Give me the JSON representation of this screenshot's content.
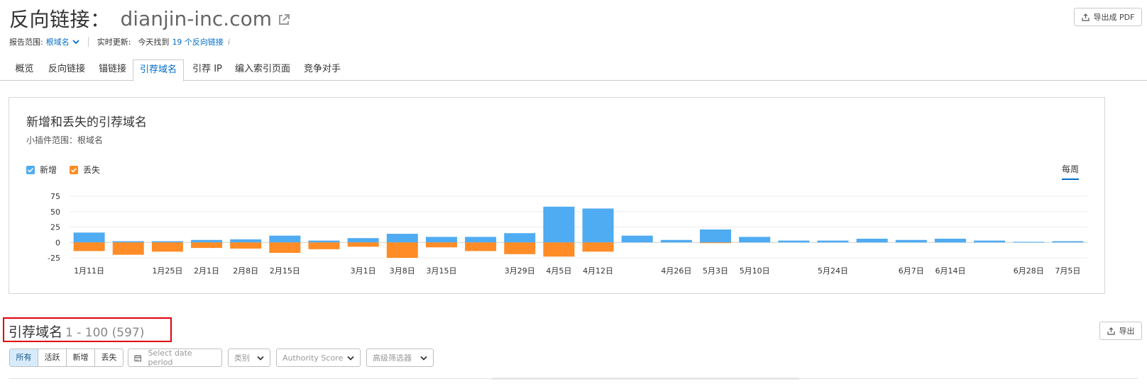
{
  "header": {
    "title": "反向链接：",
    "domain": "dianjin-inc.com",
    "export_pdf": "导出成 PDF"
  },
  "meta": {
    "scope_label": "报告范围:",
    "scope_value": "根域名",
    "realtime_label": "实时更新:",
    "today_prefix": "今天找到",
    "today_link": "19 个反向链接",
    "info": "i"
  },
  "tabs": [
    {
      "label": "概览"
    },
    {
      "label": "反向链接"
    },
    {
      "label": "锚链接"
    },
    {
      "label": "引荐域名"
    },
    {
      "label": "引荐 IP"
    },
    {
      "label": "编入索引页面"
    },
    {
      "label": "竞争对手"
    }
  ],
  "chart_card": {
    "title": "新增和丢失的引荐域名",
    "subtitle": "小插件范围：根域名",
    "legend_new": "新增",
    "legend_lost": "丢失",
    "period": "每周"
  },
  "colors": {
    "new": "#4fabf2",
    "lost": "#ff8c26",
    "accent": "#006dca",
    "highlight": "#e0000b"
  },
  "chart_data": {
    "type": "bar",
    "y_ticks": [
      "75",
      "50",
      "25",
      "0",
      "-25"
    ],
    "ylim": [
      -25,
      75
    ],
    "x_labels": [
      "1月11日",
      "",
      "1月25日",
      "2月1日",
      "2月8日",
      "2月15日",
      "",
      "3月1日",
      "3月8日",
      "3月15日",
      "",
      "3月29日",
      "4月5日",
      "4月12日",
      "",
      "4月26日",
      "5月3日",
      "5月10日",
      "",
      "5月24日",
      "",
      "6月7日",
      "6月14日",
      "",
      "6月28日",
      "7月5日"
    ],
    "series": [
      {
        "name": "新增",
        "values": [
          16,
          2,
          2,
          4,
          5,
          11,
          3,
          7,
          14,
          9,
          9,
          15,
          58,
          55,
          11,
          4,
          21,
          9,
          3,
          3,
          6,
          4,
          6,
          3,
          1,
          2
        ]
      },
      {
        "name": "丢失",
        "values": [
          -14,
          -20,
          -15,
          -9,
          -10,
          -17,
          -11,
          -7,
          -25,
          -8,
          -14,
          -19,
          -23,
          -15,
          0,
          0,
          -1,
          0,
          0,
          0,
          0,
          0,
          0,
          0,
          0,
          0
        ]
      }
    ]
  },
  "section": {
    "title": "引荐域名",
    "range": "1 - 100 (597)",
    "export": "导出"
  },
  "filters": {
    "segments": [
      "所有",
      "活跃",
      "新增",
      "丢失"
    ],
    "date_placeholder": "Select date period",
    "category": "类别",
    "authority": "Authority Score",
    "advanced": "高级筛选器"
  }
}
